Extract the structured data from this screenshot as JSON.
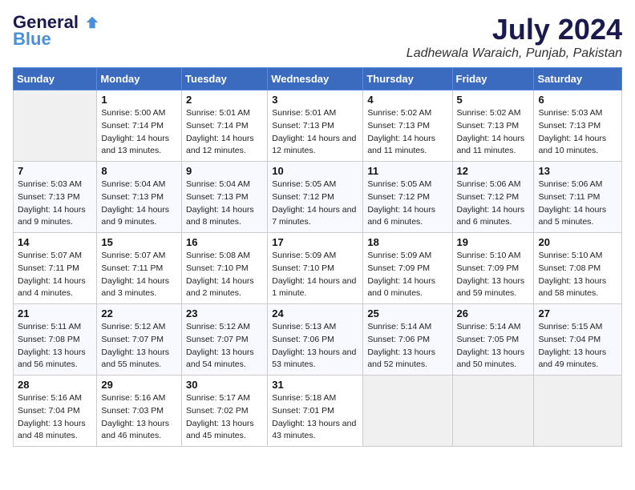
{
  "header": {
    "logo_line1": "General",
    "logo_line2": "Blue",
    "month": "July 2024",
    "location": "Ladhewala Waraich, Punjab, Pakistan"
  },
  "days_of_week": [
    "Sunday",
    "Monday",
    "Tuesday",
    "Wednesday",
    "Thursday",
    "Friday",
    "Saturday"
  ],
  "weeks": [
    [
      {
        "day": "",
        "empty": true
      },
      {
        "day": "1",
        "sunrise": "Sunrise: 5:00 AM",
        "sunset": "Sunset: 7:14 PM",
        "daylight": "Daylight: 14 hours and 13 minutes."
      },
      {
        "day": "2",
        "sunrise": "Sunrise: 5:01 AM",
        "sunset": "Sunset: 7:14 PM",
        "daylight": "Daylight: 14 hours and 12 minutes."
      },
      {
        "day": "3",
        "sunrise": "Sunrise: 5:01 AM",
        "sunset": "Sunset: 7:13 PM",
        "daylight": "Daylight: 14 hours and 12 minutes."
      },
      {
        "day": "4",
        "sunrise": "Sunrise: 5:02 AM",
        "sunset": "Sunset: 7:13 PM",
        "daylight": "Daylight: 14 hours and 11 minutes."
      },
      {
        "day": "5",
        "sunrise": "Sunrise: 5:02 AM",
        "sunset": "Sunset: 7:13 PM",
        "daylight": "Daylight: 14 hours and 11 minutes."
      },
      {
        "day": "6",
        "sunrise": "Sunrise: 5:03 AM",
        "sunset": "Sunset: 7:13 PM",
        "daylight": "Daylight: 14 hours and 10 minutes."
      }
    ],
    [
      {
        "day": "7",
        "sunrise": "Sunrise: 5:03 AM",
        "sunset": "Sunset: 7:13 PM",
        "daylight": "Daylight: 14 hours and 9 minutes."
      },
      {
        "day": "8",
        "sunrise": "Sunrise: 5:04 AM",
        "sunset": "Sunset: 7:13 PM",
        "daylight": "Daylight: 14 hours and 9 minutes."
      },
      {
        "day": "9",
        "sunrise": "Sunrise: 5:04 AM",
        "sunset": "Sunset: 7:13 PM",
        "daylight": "Daylight: 14 hours and 8 minutes."
      },
      {
        "day": "10",
        "sunrise": "Sunrise: 5:05 AM",
        "sunset": "Sunset: 7:12 PM",
        "daylight": "Daylight: 14 hours and 7 minutes."
      },
      {
        "day": "11",
        "sunrise": "Sunrise: 5:05 AM",
        "sunset": "Sunset: 7:12 PM",
        "daylight": "Daylight: 14 hours and 6 minutes."
      },
      {
        "day": "12",
        "sunrise": "Sunrise: 5:06 AM",
        "sunset": "Sunset: 7:12 PM",
        "daylight": "Daylight: 14 hours and 6 minutes."
      },
      {
        "day": "13",
        "sunrise": "Sunrise: 5:06 AM",
        "sunset": "Sunset: 7:11 PM",
        "daylight": "Daylight: 14 hours and 5 minutes."
      }
    ],
    [
      {
        "day": "14",
        "sunrise": "Sunrise: 5:07 AM",
        "sunset": "Sunset: 7:11 PM",
        "daylight": "Daylight: 14 hours and 4 minutes."
      },
      {
        "day": "15",
        "sunrise": "Sunrise: 5:07 AM",
        "sunset": "Sunset: 7:11 PM",
        "daylight": "Daylight: 14 hours and 3 minutes."
      },
      {
        "day": "16",
        "sunrise": "Sunrise: 5:08 AM",
        "sunset": "Sunset: 7:10 PM",
        "daylight": "Daylight: 14 hours and 2 minutes."
      },
      {
        "day": "17",
        "sunrise": "Sunrise: 5:09 AM",
        "sunset": "Sunset: 7:10 PM",
        "daylight": "Daylight: 14 hours and 1 minute."
      },
      {
        "day": "18",
        "sunrise": "Sunrise: 5:09 AM",
        "sunset": "Sunset: 7:09 PM",
        "daylight": "Daylight: 14 hours and 0 minutes."
      },
      {
        "day": "19",
        "sunrise": "Sunrise: 5:10 AM",
        "sunset": "Sunset: 7:09 PM",
        "daylight": "Daylight: 13 hours and 59 minutes."
      },
      {
        "day": "20",
        "sunrise": "Sunrise: 5:10 AM",
        "sunset": "Sunset: 7:08 PM",
        "daylight": "Daylight: 13 hours and 58 minutes."
      }
    ],
    [
      {
        "day": "21",
        "sunrise": "Sunrise: 5:11 AM",
        "sunset": "Sunset: 7:08 PM",
        "daylight": "Daylight: 13 hours and 56 minutes."
      },
      {
        "day": "22",
        "sunrise": "Sunrise: 5:12 AM",
        "sunset": "Sunset: 7:07 PM",
        "daylight": "Daylight: 13 hours and 55 minutes."
      },
      {
        "day": "23",
        "sunrise": "Sunrise: 5:12 AM",
        "sunset": "Sunset: 7:07 PM",
        "daylight": "Daylight: 13 hours and 54 minutes."
      },
      {
        "day": "24",
        "sunrise": "Sunrise: 5:13 AM",
        "sunset": "Sunset: 7:06 PM",
        "daylight": "Daylight: 13 hours and 53 minutes."
      },
      {
        "day": "25",
        "sunrise": "Sunrise: 5:14 AM",
        "sunset": "Sunset: 7:06 PM",
        "daylight": "Daylight: 13 hours and 52 minutes."
      },
      {
        "day": "26",
        "sunrise": "Sunrise: 5:14 AM",
        "sunset": "Sunset: 7:05 PM",
        "daylight": "Daylight: 13 hours and 50 minutes."
      },
      {
        "day": "27",
        "sunrise": "Sunrise: 5:15 AM",
        "sunset": "Sunset: 7:04 PM",
        "daylight": "Daylight: 13 hours and 49 minutes."
      }
    ],
    [
      {
        "day": "28",
        "sunrise": "Sunrise: 5:16 AM",
        "sunset": "Sunset: 7:04 PM",
        "daylight": "Daylight: 13 hours and 48 minutes."
      },
      {
        "day": "29",
        "sunrise": "Sunrise: 5:16 AM",
        "sunset": "Sunset: 7:03 PM",
        "daylight": "Daylight: 13 hours and 46 minutes."
      },
      {
        "day": "30",
        "sunrise": "Sunrise: 5:17 AM",
        "sunset": "Sunset: 7:02 PM",
        "daylight": "Daylight: 13 hours and 45 minutes."
      },
      {
        "day": "31",
        "sunrise": "Sunrise: 5:18 AM",
        "sunset": "Sunset: 7:01 PM",
        "daylight": "Daylight: 13 hours and 43 minutes."
      },
      {
        "day": "",
        "empty": true
      },
      {
        "day": "",
        "empty": true
      },
      {
        "day": "",
        "empty": true
      }
    ]
  ]
}
